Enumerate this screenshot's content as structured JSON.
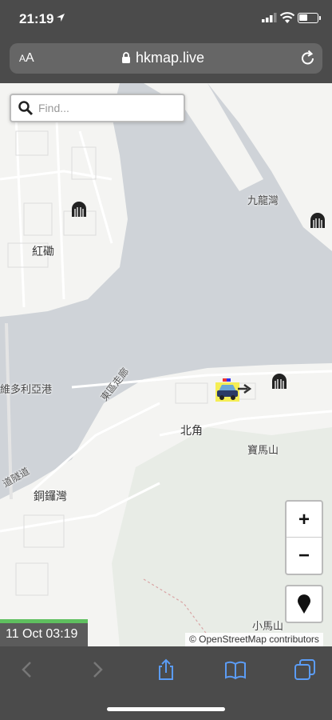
{
  "status_bar": {
    "time": "21:19"
  },
  "browser": {
    "text_size_label": "AA",
    "url": "hkmap.live"
  },
  "map": {
    "search_placeholder": "Find...",
    "labels": {
      "kowloon_bay": "九龍灣",
      "hung_hom": "紅磡",
      "victoria_harbour": "維多利亞港",
      "eastern_corridor": "東區走廊",
      "north_point": "北角",
      "braemar_hill": "寶馬山",
      "causeway_bay": "銅鑼灣",
      "tunnel_road": "道隧道",
      "mount_parker": "小馬山"
    },
    "zoom_in_label": "+",
    "zoom_out_label": "−",
    "timestamp": "11 Oct 03:19",
    "attribution": "© OpenStreetMap contributors"
  },
  "colors": {
    "water": "#cfd3d8",
    "land": "#f4f4f2",
    "timebar": "#5fbf5f"
  },
  "toolbar": {
    "icons": [
      "back-icon",
      "forward-icon",
      "share-icon",
      "bookmarks-icon",
      "tabs-icon"
    ]
  }
}
